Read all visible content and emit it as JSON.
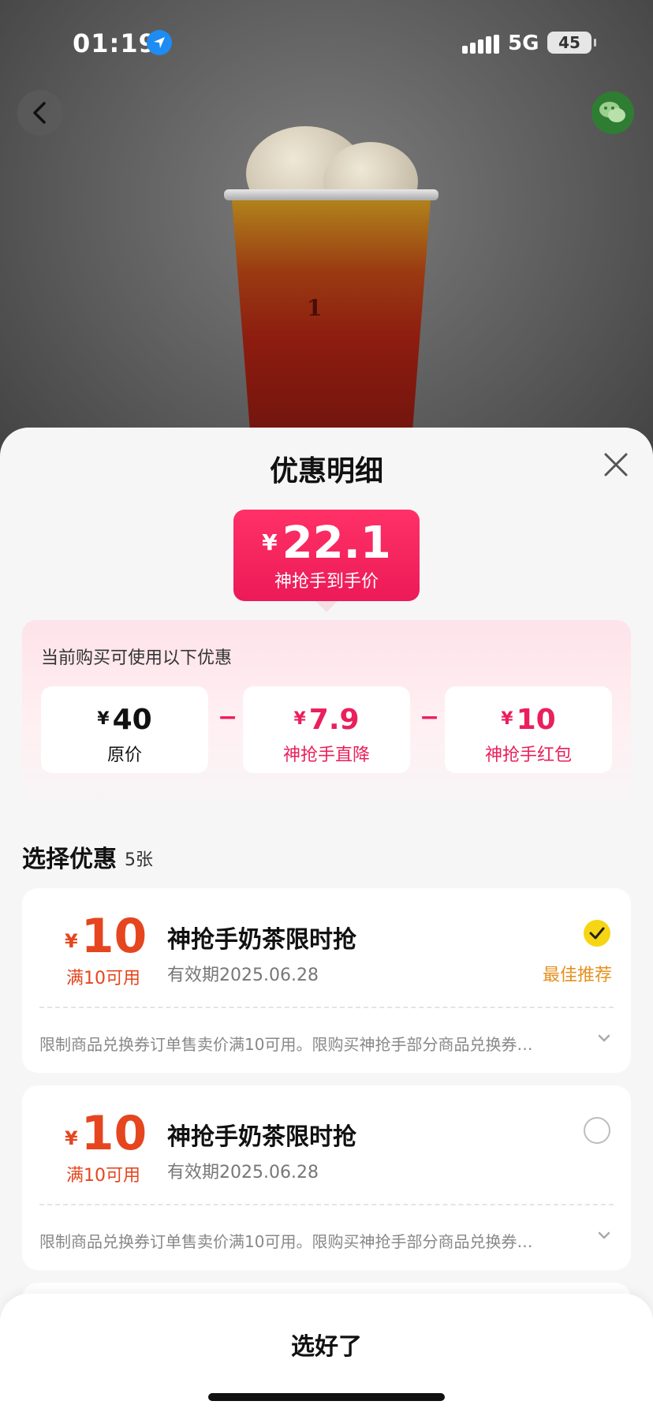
{
  "status_bar": {
    "time": "01:19",
    "network": "5G",
    "battery": "45"
  },
  "sheet": {
    "title": "优惠明细",
    "final_price": {
      "currency": "¥",
      "amount": "22.1",
      "label": "神抢手到手价"
    },
    "breakdown": {
      "title": "当前购买可使用以下优惠",
      "operator": "−",
      "items": [
        {
          "currency": "¥",
          "amount": "40",
          "label": "原价"
        },
        {
          "currency": "¥",
          "amount": "7.9",
          "label": "神抢手直降"
        },
        {
          "currency": "¥",
          "amount": "10",
          "label": "神抢手红包"
        }
      ]
    },
    "select_section": {
      "title": "选择优惠",
      "count": "5张"
    },
    "coupons": [
      {
        "currency": "¥",
        "amount": "10",
        "condition": "满10可用",
        "name": "神抢手奶茶限时抢",
        "validity": "有效期2025.06.28",
        "selected": true,
        "badge": "最佳推荐",
        "rule": "限制商品兑换券订单售卖价满10可用。限购买神抢手部分商品兑换券…"
      },
      {
        "currency": "¥",
        "amount": "10",
        "condition": "满10可用",
        "name": "神抢手奶茶限时抢",
        "validity": "有效期2025.06.28",
        "selected": false,
        "rule": "限制商品兑换券订单售卖价满10可用。限购买神抢手部分商品兑换券…"
      }
    ],
    "confirm_label": "选好了"
  },
  "colors": {
    "accent_pink": "#ea1f5c",
    "coupon_orange": "#e5461f",
    "recommend_orange": "#e5911f",
    "check_yellow": "#f6d514"
  }
}
